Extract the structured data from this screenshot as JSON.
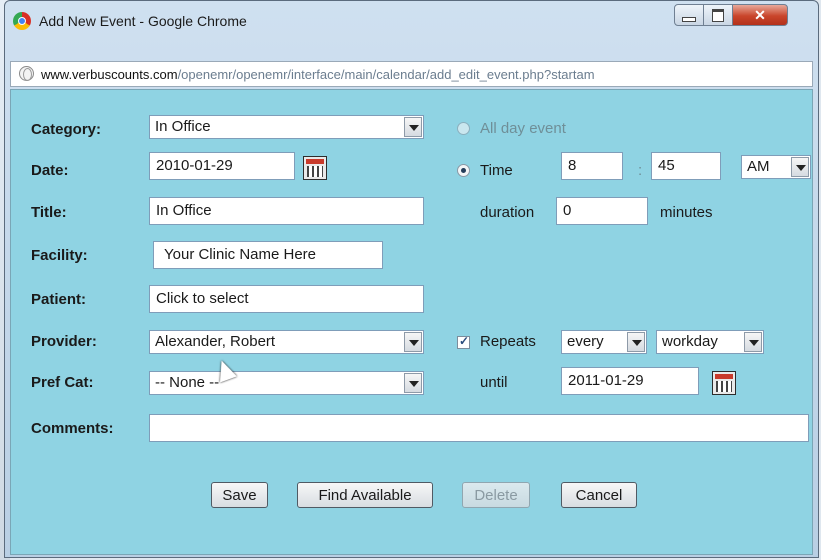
{
  "window": {
    "title": "Add New Event - Google Chrome",
    "url_host": "www.verbuscounts.com",
    "url_path": "/openemr/openemr/interface/main/calendar/add_edit_event.php?startam"
  },
  "form": {
    "category_label": "Category:",
    "category_value": "In Office",
    "all_day_label": "All day event",
    "date_label": "Date:",
    "date_value": "2010-01-29",
    "time_label": "Time",
    "hour_value": "8",
    "time_sep": ":",
    "minute_value": "45",
    "ampm_value": "AM",
    "title_label": "Title:",
    "title_value": "In Office",
    "duration_label": "duration",
    "duration_value": "0",
    "minutes_label": "minutes",
    "facility_label": "Facility:",
    "facility_value": "Your Clinic Name Here",
    "patient_label": "Patient:",
    "patient_value": "Click to select",
    "provider_label": "Provider:",
    "provider_value": "Alexander, Robert",
    "repeats_label": "Repeats",
    "repeat_every_value": "every",
    "repeat_unit_value": "workday",
    "prefcat_label": "Pref Cat:",
    "prefcat_value": "-- None --",
    "until_label": "until",
    "until_value": "2011-01-29",
    "comments_label": "Comments:",
    "comments_value": ""
  },
  "buttons": {
    "save": "Save",
    "find_available": "Find Available",
    "delete": "Delete",
    "cancel": "Cancel"
  }
}
